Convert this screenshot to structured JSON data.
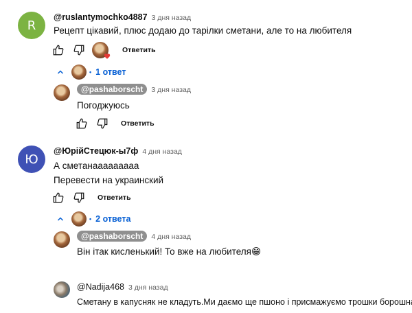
{
  "comments": [
    {
      "avatar_letter": "R",
      "avatar_color": "#7cb342",
      "author": "@ruslantymochko4887",
      "time": "3 дня назад",
      "text_lines": [
        "Рецепт цікавий, плюс додаю до тарілки сметани, але то на любителя"
      ],
      "reply_label": "Ответить",
      "replies_toggle": "1 ответ",
      "replies": [
        {
          "author": "@pashaborscht",
          "time": "3 дня назад",
          "text": "Погоджуюсь",
          "reply_label": "Ответить"
        }
      ]
    },
    {
      "avatar_letter": "Ю",
      "avatar_color": "#3f51b5",
      "author": "@ЮрійСтецюк-ы7ф",
      "time": "4 дня назад",
      "text_lines": [
        "А сметанааааааааа",
        "Перевести на украинский"
      ],
      "reply_label": "Ответить",
      "replies_toggle": "2 ответа",
      "replies": [
        {
          "author": "@pashaborscht",
          "time": "4 дня назад",
          "text": "Він ітак кисленький! То вже на любителя😁"
        },
        {
          "author": "@Nadija468",
          "time": "3 дня назад",
          "text": "Сметану в капусняк не кладуть.Ми даємо ще пшоно і присмажуємо трошки борошна."
        }
      ]
    }
  ],
  "icons": {
    "like": "thumb-up-icon",
    "dislike": "thumb-down-icon",
    "heart": "heart-icon",
    "chevron": "chevron-up-icon"
  },
  "colors": {
    "link": "#065fd4",
    "heart": "#e53935",
    "chip": "#8f8f8f"
  }
}
